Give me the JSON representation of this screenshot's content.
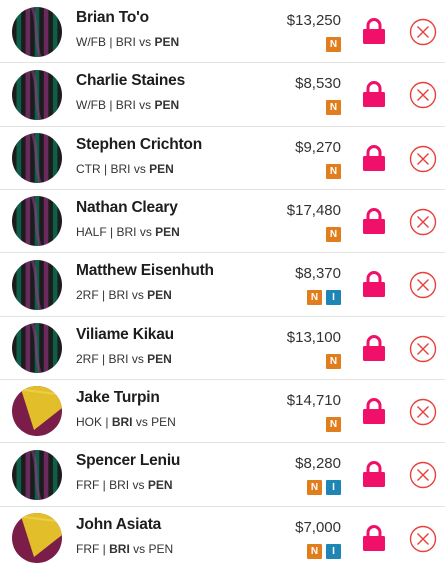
{
  "players": [
    {
      "name": "Brian To'o",
      "position": "W/FB",
      "home": "BRI",
      "away": "PEN",
      "bold_team": "PEN",
      "price": "$13,250",
      "badges": [
        "N"
      ],
      "jersey": "stripes",
      "lock_icon": "lock-icon",
      "remove_icon": "remove-icon"
    },
    {
      "name": "Charlie Staines",
      "position": "W/FB",
      "home": "BRI",
      "away": "PEN",
      "bold_team": "PEN",
      "price": "$8,530",
      "badges": [
        "N"
      ],
      "jersey": "stripes",
      "lock_icon": "lock-icon",
      "remove_icon": "remove-icon"
    },
    {
      "name": "Stephen Crichton",
      "position": "CTR",
      "home": "BRI",
      "away": "PEN",
      "bold_team": "PEN",
      "price": "$9,270",
      "badges": [
        "N"
      ],
      "jersey": "stripes",
      "lock_icon": "lock-icon",
      "remove_icon": "remove-icon"
    },
    {
      "name": "Nathan Cleary",
      "position": "HALF",
      "home": "BRI",
      "away": "PEN",
      "bold_team": "PEN",
      "price": "$17,480",
      "badges": [
        "N"
      ],
      "jersey": "stripes",
      "lock_icon": "lock-icon",
      "remove_icon": "remove-icon"
    },
    {
      "name": "Matthew Eisenhuth",
      "position": "2RF",
      "home": "BRI",
      "away": "PEN",
      "bold_team": "PEN",
      "price": "$8,370",
      "badges": [
        "N",
        "I"
      ],
      "jersey": "stripes",
      "lock_icon": "lock-icon",
      "remove_icon": "remove-icon"
    },
    {
      "name": "Viliame Kikau",
      "position": "2RF",
      "home": "BRI",
      "away": "PEN",
      "bold_team": "PEN",
      "price": "$13,100",
      "badges": [
        "N"
      ],
      "jersey": "stripes",
      "lock_icon": "lock-icon",
      "remove_icon": "remove-icon"
    },
    {
      "name": "Jake Turpin",
      "position": "HOK",
      "home": "BRI",
      "away": "PEN",
      "bold_team": "BRI",
      "price": "$14,710",
      "badges": [
        "N"
      ],
      "jersey": "diagonal",
      "lock_icon": "lock-icon",
      "remove_icon": "remove-icon"
    },
    {
      "name": "Spencer Leniu",
      "position": "FRF",
      "home": "BRI",
      "away": "PEN",
      "bold_team": "PEN",
      "price": "$8,280",
      "badges": [
        "N",
        "I"
      ],
      "jersey": "stripes",
      "lock_icon": "lock-icon",
      "remove_icon": "remove-icon"
    },
    {
      "name": "John Asiata",
      "position": "FRF",
      "home": "BRI",
      "away": "PEN",
      "bold_team": "BRI",
      "price": "$7,000",
      "badges": [
        "N",
        "I"
      ],
      "jersey": "diagonal",
      "lock_icon": "lock-icon",
      "remove_icon": "remove-icon"
    }
  ],
  "separator": " | ",
  "versus": " vs ",
  "colors": {
    "lock": "#f0106a",
    "remove": "#e8413b",
    "badge_n": "#e07e1e",
    "badge_i": "#1e86b4",
    "stripe_dark": "#1c1c1c",
    "stripe_green": "#0e5e4a",
    "stripe_purple": "#6b2a5e",
    "maroon": "#7b1d49",
    "gold": "#e2bf2a"
  }
}
